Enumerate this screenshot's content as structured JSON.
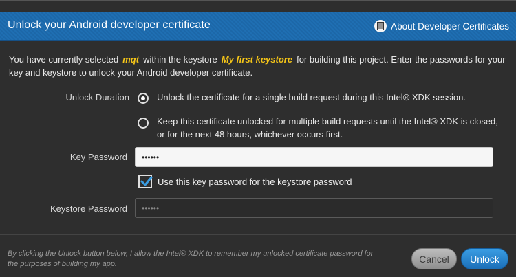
{
  "header": {
    "title": "Unlock your Android developer certificate",
    "about_label": "About Developer Certificates",
    "about_icon": "document-icon"
  },
  "intro": {
    "part1": "You have currently selected",
    "key_name": "mqt",
    "part2": "within the keystore",
    "keystore_name": "My first keystore",
    "part3": "for building this project. Enter the passwords for your key and keystore to unlock your Android developer certificate."
  },
  "unlock_duration": {
    "label": "Unlock Duration",
    "options": [
      {
        "text": "Unlock the certificate for a single build request during this Intel® XDK session.",
        "selected": true
      },
      {
        "text": "Keep this certificate unlocked for multiple build requests until the Intel® XDK is closed, or for the next 48 hours, whichever occurs first.",
        "selected": false
      }
    ]
  },
  "key_password": {
    "label": "Key Password",
    "value": "••••••"
  },
  "use_key_password": {
    "label": "Use this key password for the keystore password",
    "checked": true
  },
  "keystore_password": {
    "label": "Keystore Password",
    "value": "••••••"
  },
  "footer": {
    "note": "By clicking the Unlock button below, I allow the Intel® XDK to remember my unlocked certificate password for the purposes of building my app.",
    "cancel_label": "Cancel",
    "unlock_label": "Unlock"
  },
  "colors": {
    "header_blue": "#1f6fb3",
    "highlight_yellow": "#f5c518",
    "unlock_button": "#2a86d0"
  }
}
